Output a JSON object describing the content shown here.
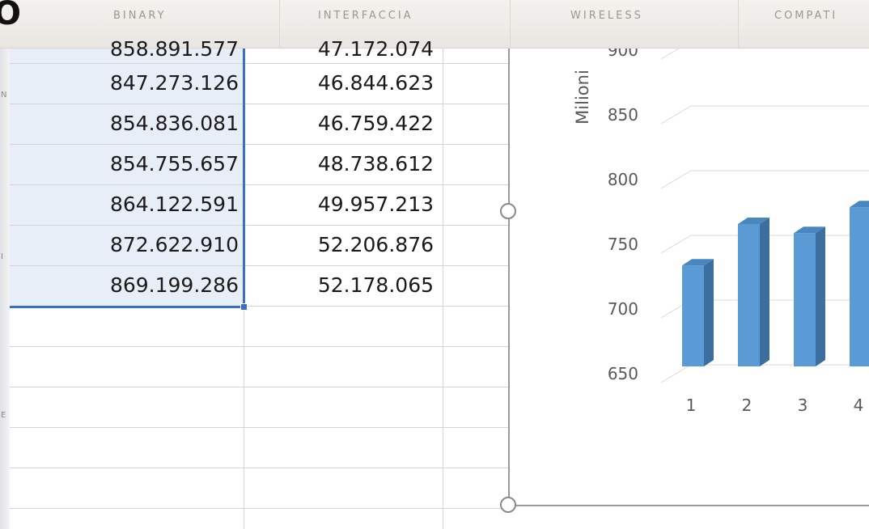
{
  "banner": {
    "logo_fragment": "O",
    "items": [
      "BINARY",
      "INTERFACCIA",
      "WIRELESS",
      "COMPATI"
    ]
  },
  "left_edge_glyphs": [
    "N",
    "I",
    "E"
  ],
  "sheet": {
    "partial_row": [
      "858.891.577",
      "47.172.074"
    ],
    "rows": [
      [
        "847.273.126",
        "46.844.623"
      ],
      [
        "854.836.081",
        "46.759.422"
      ],
      [
        "854.755.657",
        "48.738.612"
      ],
      [
        "864.122.591",
        "49.957.213"
      ],
      [
        "872.622.910",
        "52.206.876"
      ],
      [
        "869.199.286",
        "52.178.065"
      ]
    ]
  },
  "chart_data": {
    "type": "bar",
    "ylabel": "Milioni",
    "yticks": [
      "650",
      "700",
      "750",
      "800",
      "850",
      "900"
    ],
    "ylim": [
      650,
      900
    ],
    "categories": [
      "1",
      "2",
      "3",
      "4"
    ],
    "series": [
      {
        "values": [
          728,
          760,
          753,
          773
        ]
      }
    ],
    "color": "#5b9bd5"
  }
}
